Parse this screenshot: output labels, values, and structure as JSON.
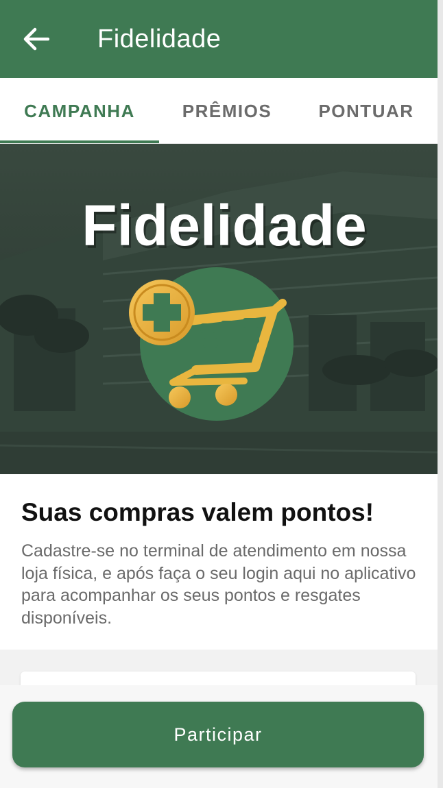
{
  "header": {
    "title": "Fidelidade",
    "back_icon": "arrow-left-icon"
  },
  "tabs": [
    {
      "label": "CAMPANHA",
      "active": true
    },
    {
      "label": "PRÊMIOS",
      "active": false
    },
    {
      "label": "PONTUAR",
      "active": false
    }
  ],
  "banner": {
    "title": "Fidelidade",
    "icon": "shopping-cart-plus-icon"
  },
  "content": {
    "headline": "Suas compras valem pontos!",
    "description": "Cadastre-se no terminal de atendimento em nossa loja física, e após faça o seu login aqui no aplicativo para acompanhar os seus pontos e resgates disponíveis."
  },
  "actions": {
    "participar_label": "Participar"
  },
  "colors": {
    "primary": "#3f7a53",
    "gold": "#e8b03a",
    "tab_inactive": "#6b6b6b"
  }
}
